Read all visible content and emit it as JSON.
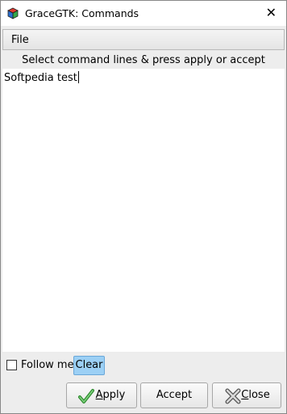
{
  "window": {
    "title": "GraceGTK: Commands",
    "close_glyph": "✕"
  },
  "menu": {
    "file": "File"
  },
  "hint": "Select command lines & press apply or accept",
  "editor": {
    "content": "Softpedia test"
  },
  "follow": {
    "label": "Follow me",
    "checked": false
  },
  "clear_label": "Clear",
  "buttons": {
    "apply_mnemonic": "A",
    "apply_rest": "pply",
    "accept": "Accept",
    "close_mnemonic": "C",
    "close_rest": "lose"
  },
  "colors": {
    "clear_bg": "#9cd0f5",
    "apply_icon": "#3aa03a",
    "close_icon": "#c0c0c0"
  },
  "icons": {
    "app": "gracegtk-cube-icon",
    "apply": "check-icon",
    "close": "x-icon"
  }
}
